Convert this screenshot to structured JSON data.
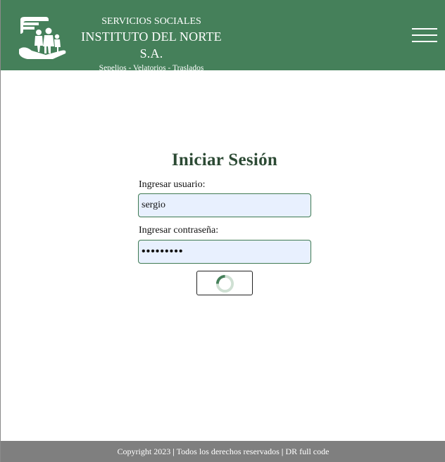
{
  "header": {
    "line1": "SERVICIOS SOCIALES",
    "line2": "INSTITUTO DEL NORTE S.A.",
    "line3": "Sepelios - Velatorios - Traslados",
    "logo_icon": "family-in-hands-icon",
    "menu_icon": "hamburger-menu-icon",
    "bg_color": "#45805a"
  },
  "login": {
    "title": "Iniciar Sesión",
    "user_label": "Ingresar usuario:",
    "user_value": "sergio",
    "pass_label": "Ingresar contraseña:",
    "pass_value": "•••••••••",
    "submit_icon": "loading-spinner-icon"
  },
  "footer": {
    "copyright": "Copyright 2023",
    "sep1": "|",
    "rights": "Todos los derechos reservados",
    "sep2": "|",
    "credit": "DR full code"
  }
}
